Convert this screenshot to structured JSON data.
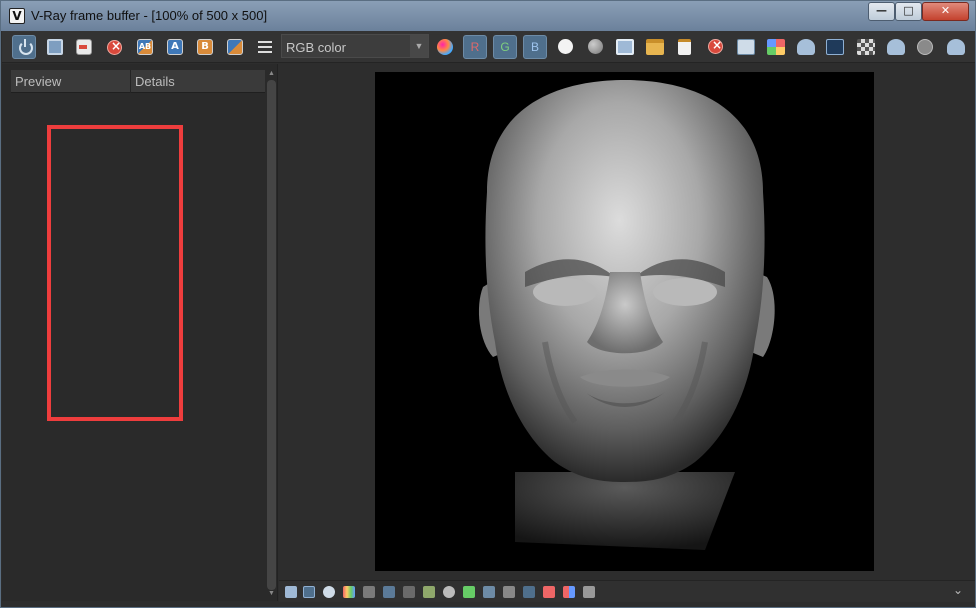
{
  "window": {
    "title": "V-Ray frame buffer - [100% of 500 x 500]",
    "app_icon": "V",
    "controls": {
      "minimize": "—",
      "maximize": "□",
      "close": "✕"
    }
  },
  "toolbar": {
    "channel": "RGB color",
    "channel_toggles": {
      "r": "R",
      "g": "G",
      "b": "B"
    },
    "compare": {
      "a": "A",
      "b": "B",
      "ab": "AB"
    },
    "icons": [
      "power-icon",
      "save-icon",
      "load-icon",
      "clear-icon",
      "compare-ab-icon",
      "ab-a-icon",
      "ab-b-icon",
      "compare-switch-icon",
      "menu-icon",
      "color-corrections-icon",
      "white-circle-icon",
      "gray-circle-icon",
      "save-image-icon",
      "open-folder-icon",
      "clipboard-icon",
      "stop-icon",
      "region-icon",
      "track-mouse-icon",
      "teapot-icon",
      "lens-effects-icon",
      "checker-icon",
      "render-interactive-icon",
      "stop-render-icon",
      "render-icon"
    ]
  },
  "left_panel": {
    "tabs": [
      "Preview",
      "Details"
    ],
    "highlight_color": "#ee3d3d"
  },
  "render": {
    "resolution": "500 x 500",
    "zoom": "100%",
    "content": "render-head-image"
  },
  "colors": {
    "accent_button": "#4f6f8c",
    "panel_bg": "#2a2a2a",
    "toolbar_bg": "#333333"
  }
}
